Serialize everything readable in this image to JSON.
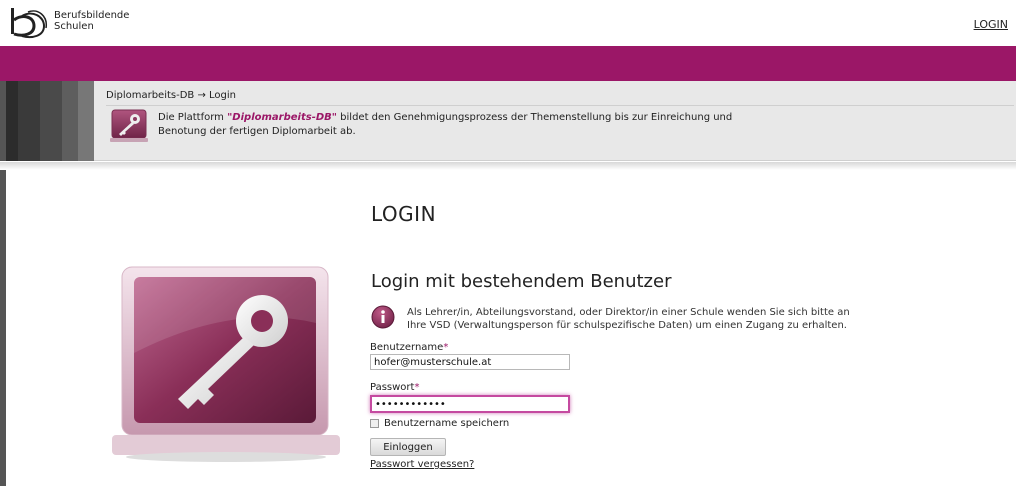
{
  "header": {
    "logo_line1": "Berufsbildende",
    "logo_line2": "Schulen",
    "login_link": "LOGIN",
    "brand_color": "#9b1767"
  },
  "infoband": {
    "breadcrumb": "Diplomarbeits-DB → Login",
    "description_prefix": "Die Plattform ",
    "description_brand": "\"Diplomarbeits-DB\"",
    "description_suffix": " bildet den Genehmigungsprozess der Themenstellung bis zur Einreichung und Benotung der fertigen Diplomarbeit ab.",
    "icon": "key-icon"
  },
  "main": {
    "page_title": "LOGIN",
    "section_title": "Login mit bestehendem Benutzer",
    "hint_icon": "info-icon",
    "hint_text": "Als Lehrer/in, Abteilungsvorstand, oder Direktor/in einer Schule wenden Sie sich bitte an Ihre VSD (Verwaltungsperson für schulspezifische Daten) um einen Zugang zu erhalten.",
    "username_label": "Benutzername",
    "username_value": "hofer@musterschule.at",
    "password_label": "Passwort",
    "password_value": "••••••••••••",
    "required_marker": "*",
    "remember_label": "Benutzername speichern",
    "submit_label": "Einloggen",
    "forgot_link": "Passwort vergessen?"
  }
}
